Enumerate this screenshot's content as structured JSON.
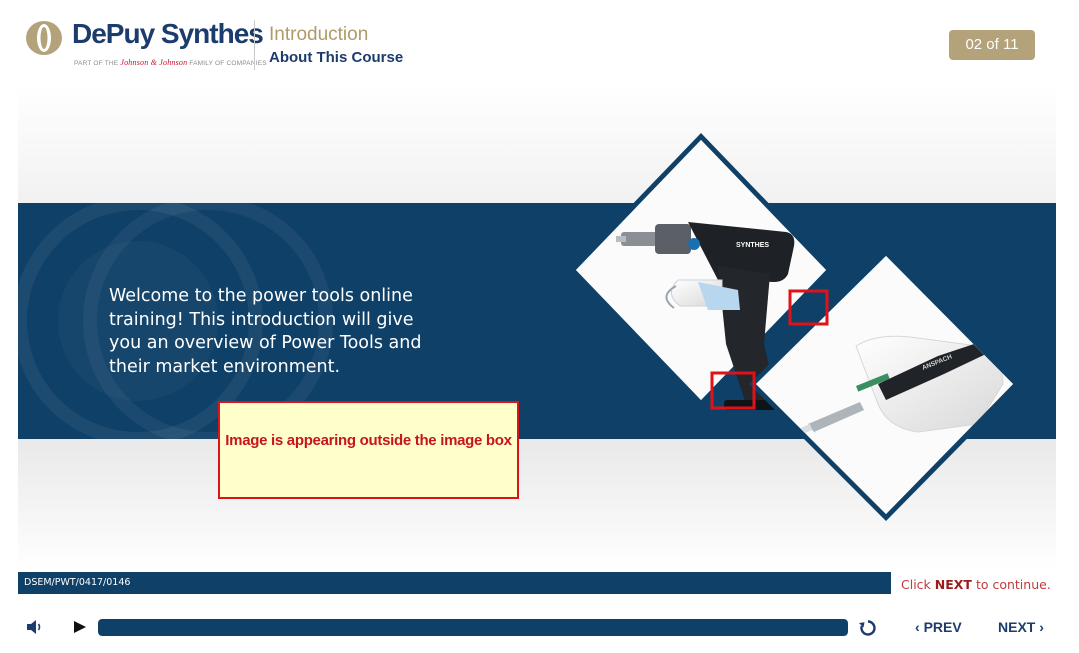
{
  "header": {
    "brand": "DePuy Synthes",
    "tagline_prefix": "PART OF THE",
    "tagline_jj": "Johnson & Johnson",
    "tagline_suffix": "FAMILY OF COMPANIES",
    "section_title": "Introduction",
    "section_subtitle": "About This Course",
    "page_counter": "02 of 11"
  },
  "slide": {
    "welcome_text": "Welcome to the power tools online training! This introduction will give you an overview of Power Tools and their market environment.",
    "drill_label": "SYNTHES",
    "handpiece_label": "ANSPACH",
    "callout_text": "Image is appearing outside the image box"
  },
  "footer": {
    "code": "DSEM/PWT/0417/0146",
    "hint_prefix": "Click",
    "hint_action": "NEXT",
    "hint_suffix": "to continue."
  },
  "player": {
    "progress": 1.0,
    "prev_label": "PREV",
    "next_label": "NEXT",
    "volume_icon": "speaker-icon",
    "play_icon": "play-icon",
    "replay_icon": "replay-icon"
  },
  "colors": {
    "navy": "#0f4068",
    "gold": "#b4a27a",
    "annotation_red": "#d9151b",
    "callout_bg": "#ffffcc"
  }
}
